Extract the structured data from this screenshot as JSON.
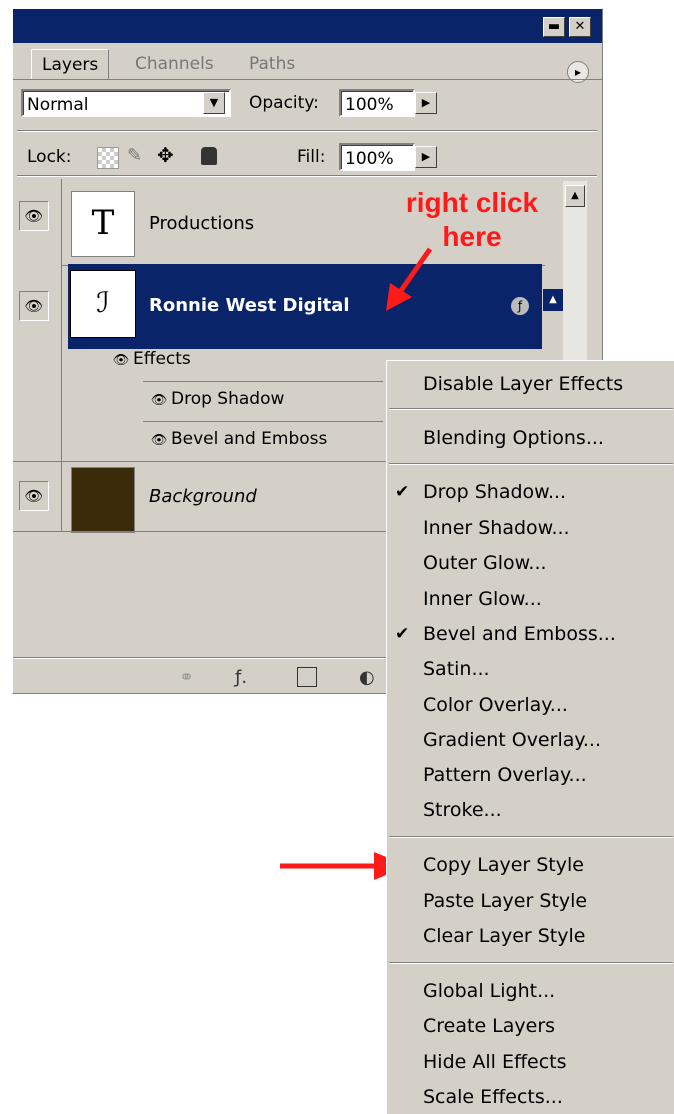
{
  "panel": {
    "title_buttons": {
      "minimize": "▬",
      "close": "✕"
    },
    "tabs": [
      {
        "label": "Layers"
      },
      {
        "label": "Channels"
      },
      {
        "label": "Paths"
      }
    ],
    "menu_icon": "▸",
    "blend_mode": "Normal",
    "opacity_label": "Opacity:",
    "opacity_value": "100%",
    "lock_label": "Lock:",
    "fill_label": "Fill:",
    "fill_value": "100%"
  },
  "layers": [
    {
      "name": "Productions",
      "thumb": "T",
      "visible": true
    },
    {
      "name": "Ronnie West Digital",
      "thumb": "ℐ",
      "visible": true,
      "selected": true,
      "effects_label": "Effects",
      "effects": [
        "Drop Shadow",
        "Bevel and Emboss"
      ]
    },
    {
      "name": "Background",
      "thumb_color": "#3a2c08",
      "visible": true
    }
  ],
  "context_menu": {
    "items": [
      {
        "label": "Disable Layer Effects",
        "checked": false
      },
      {
        "label": "Blending Options...",
        "checked": false
      },
      {
        "label": "Drop Shadow...",
        "checked": true
      },
      {
        "label": "Inner Shadow...",
        "checked": false
      },
      {
        "label": "Outer Glow...",
        "checked": false
      },
      {
        "label": "Inner Glow...",
        "checked": false
      },
      {
        "label": "Bevel and Emboss...",
        "checked": true
      },
      {
        "label": "Satin...",
        "checked": false
      },
      {
        "label": "Color Overlay...",
        "checked": false
      },
      {
        "label": "Gradient Overlay...",
        "checked": false
      },
      {
        "label": "Pattern Overlay...",
        "checked": false
      },
      {
        "label": "Stroke...",
        "checked": false
      },
      {
        "label": "Copy Layer Style",
        "checked": false
      },
      {
        "label": "Paste Layer Style",
        "checked": false
      },
      {
        "label": "Clear Layer Style",
        "checked": false
      },
      {
        "label": "Global Light...",
        "checked": false
      },
      {
        "label": "Create Layers",
        "checked": false
      },
      {
        "label": "Hide All Effects",
        "checked": false
      },
      {
        "label": "Scale Effects...",
        "checked": false
      }
    ],
    "check_glyph": "✔"
  },
  "annotations": {
    "right_click_line1": "right click",
    "right_click_line2": "here"
  },
  "colors": {
    "panel_bg": "#d4d0c8",
    "titlebar": "#0a246a",
    "selection": "#0a246a",
    "annotation_red": "#ff1a1a",
    "background_swatch": "#3a2c08"
  }
}
